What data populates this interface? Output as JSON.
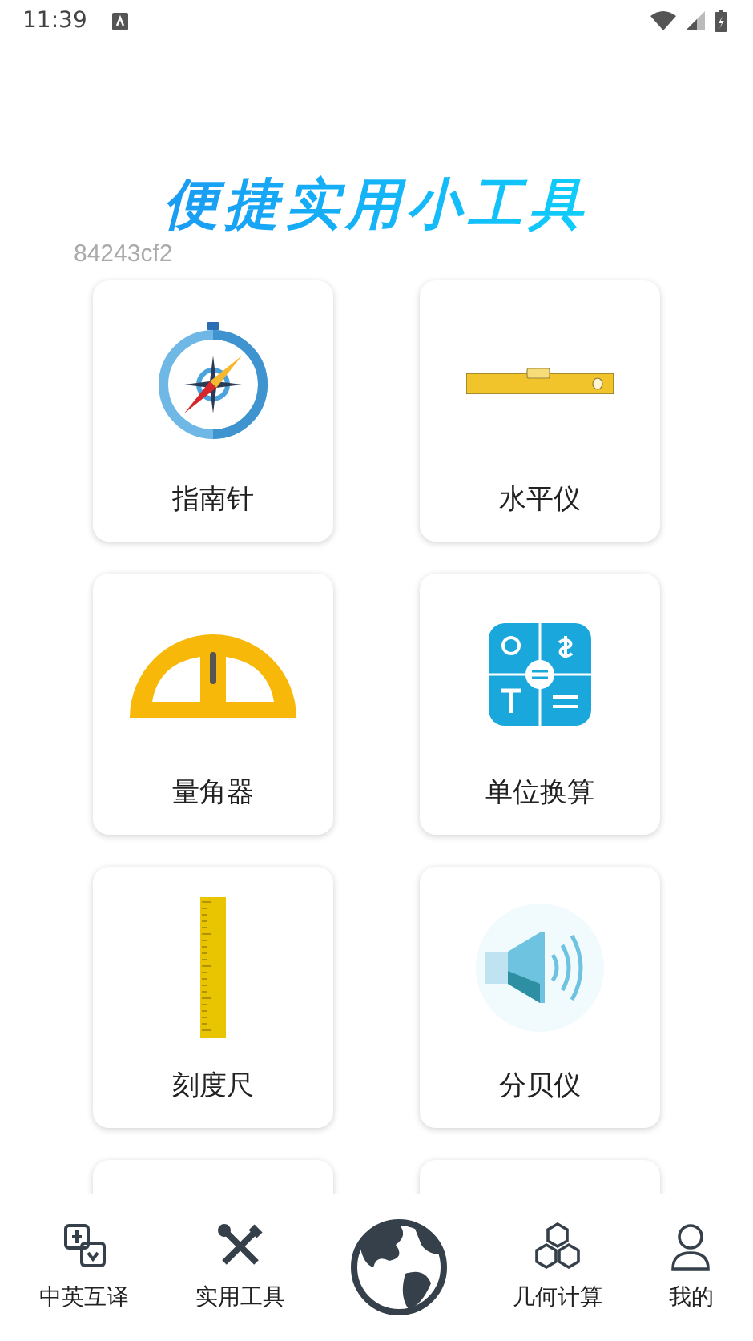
{
  "status_bar": {
    "time": "11:39"
  },
  "header": {
    "title": "便捷实用小工具",
    "build_id": "84243cf2"
  },
  "tools": [
    {
      "label": "指南针",
      "kind": "compass"
    },
    {
      "label": "水平仪",
      "kind": "level"
    },
    {
      "label": "量角器",
      "kind": "protractor"
    },
    {
      "label": "单位换算",
      "kind": "converter"
    },
    {
      "label": "刻度尺",
      "kind": "ruler"
    },
    {
      "label": "分贝仪",
      "kind": "speaker"
    }
  ],
  "bottom_nav": [
    {
      "label": "中英互译",
      "kind": "translate"
    },
    {
      "label": "实用工具",
      "kind": "tools"
    },
    {
      "kind": "globe"
    },
    {
      "label": "几何计算",
      "kind": "geometry"
    },
    {
      "label": "我的",
      "kind": "user"
    }
  ]
}
